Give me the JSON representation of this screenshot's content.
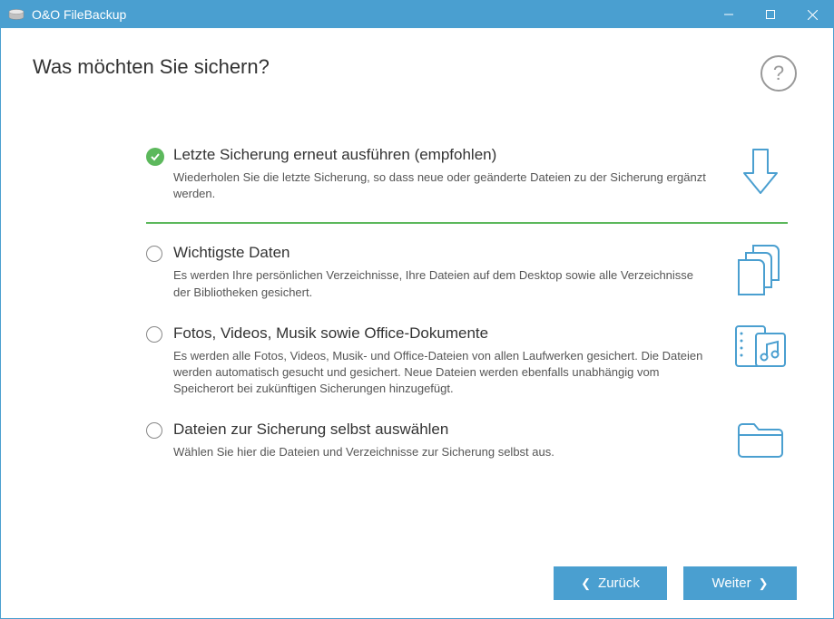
{
  "window": {
    "title": "O&O FileBackup"
  },
  "header": {
    "title": "Was möchten Sie sichern?"
  },
  "options": [
    {
      "title": "Letzte Sicherung erneut ausführen (empfohlen)",
      "description": "Wiederholen Sie die letzte Sicherung, so dass neue oder geänderte Dateien zu der Sicherung ergänzt werden.",
      "selected": true
    },
    {
      "title": "Wichtigste Daten",
      "description": "Es werden Ihre persönlichen Verzeichnisse, Ihre Dateien auf dem Desktop sowie alle Verzeichnisse der Bibliotheken gesichert.",
      "selected": false
    },
    {
      "title": "Fotos, Videos, Musik sowie Office-Dokumente",
      "description": "Es werden alle Fotos, Videos, Musik- und Office-Dateien von allen Laufwerken gesichert. Die Dateien werden automatisch gesucht und gesichert. Neue Dateien werden ebenfalls unabhängig vom Speicherort bei zukünftigen Sicherungen hinzugefügt.",
      "selected": false
    },
    {
      "title": "Dateien zur Sicherung selbst auswählen",
      "description": "Wählen Sie hier die Dateien und Verzeichnisse zur Sicherung selbst aus.",
      "selected": false
    }
  ],
  "footer": {
    "back_label": "Zurück",
    "next_label": "Weiter"
  },
  "help_glyph": "?"
}
